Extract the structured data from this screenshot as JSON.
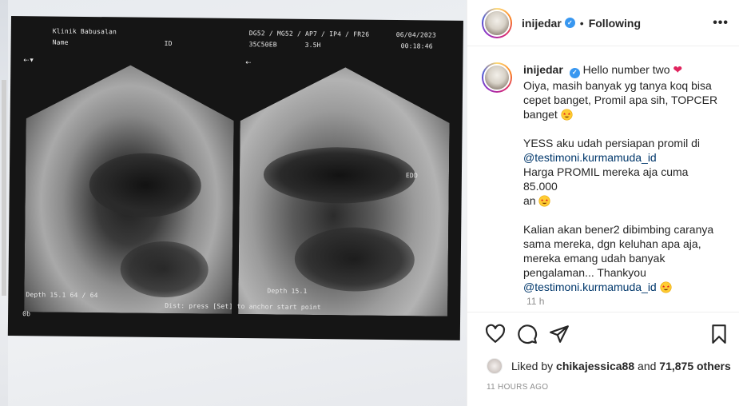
{
  "post": {
    "username": "inijedar",
    "following_label": "Following",
    "more_label": "•••"
  },
  "photo": {
    "overlay": {
      "clinic": "Klinik Babusalan",
      "name_label": "Name",
      "id_label": "ID",
      "params": "DG52 / MG52 / AP7 / IP4 / FR26",
      "date": "06/04/2023",
      "probe": "35C50EB",
      "depth_value": "3.5H",
      "time": "00:18:46",
      "depth_left": "Depth  15.1   64  / 64",
      "depth_right": "Depth  15.1",
      "dist": "Dist: press [Set] to anchor start point",
      "corner": "0b",
      "edd": "EDD"
    }
  },
  "caption": {
    "username": "inijedar",
    "lines": [
      "Hello number two",
      "Oiya, masih banyak yg tanya koq bisa",
      "cepet banget, Promil apa sih, TOPCER",
      "banget",
      "YESS aku udah persiapan promil di",
      "@testimoni.kurmamuda_id",
      "Harga PROMIL mereka aja cuma 85.000",
      "an",
      "Kalian akan bener2 dibimbing caranya",
      "sama mereka, dgn keluhan apa aja,",
      "mereka emang udah banyak",
      "pengalaman... Thankyou",
      "@testimoni.kurmamuda_id"
    ],
    "age": "11 h"
  },
  "likes": {
    "prefix": "Liked by",
    "user": "chikajessica88",
    "and": "and",
    "count": "71,875 others"
  },
  "posted_time": "11 HOURS AGO",
  "icons": {
    "like": "heart-outline-icon",
    "comment": "comment-icon",
    "share": "paper-plane-icon",
    "save": "bookmark-icon",
    "verified": "verified-badge-icon",
    "heart_emoji": "red-heart-emoji",
    "star_eyes": "star-struck-emoji"
  },
  "colors": {
    "verified": "#3897f0",
    "mention": "#00376b",
    "heart": "#e0245e",
    "muted": "#8e8e8e"
  }
}
